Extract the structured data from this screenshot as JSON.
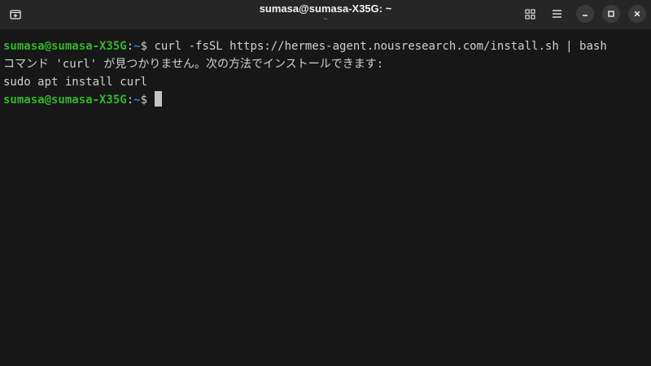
{
  "window": {
    "title": "sumasa@sumasa-X35G: ~",
    "subtitle": "~"
  },
  "headerbar": {
    "new_tab_icon": "new-tab-icon",
    "view_tabs_icon": "grid-icon",
    "menu_icon": "hamburger-menu-icon",
    "minimize_icon": "minimize-icon",
    "maximize_icon": "maximize-icon",
    "close_icon": "close-icon"
  },
  "terminal": {
    "lines": [
      {
        "user_host": "sumasa@sumasa-X35G",
        "colon": ":",
        "path": "~",
        "prompt": "$ ",
        "command": "curl -fsSL https://hermes-agent.nousresearch.com/install.sh | bash"
      },
      {
        "text": "コマンド 'curl' が見つかりません。次の方法でインストールできます:"
      },
      {
        "text": "sudo apt install curl"
      },
      {
        "user_host": "sumasa@sumasa-X35G",
        "colon": ":",
        "path": "~",
        "prompt": "$ ",
        "command": ""
      }
    ]
  },
  "colors": {
    "background": "#171717",
    "headerbar": "#262626",
    "prompt_user": "#36b52b",
    "prompt_path": "#3a7fe0",
    "text": "#d0d0d0"
  }
}
